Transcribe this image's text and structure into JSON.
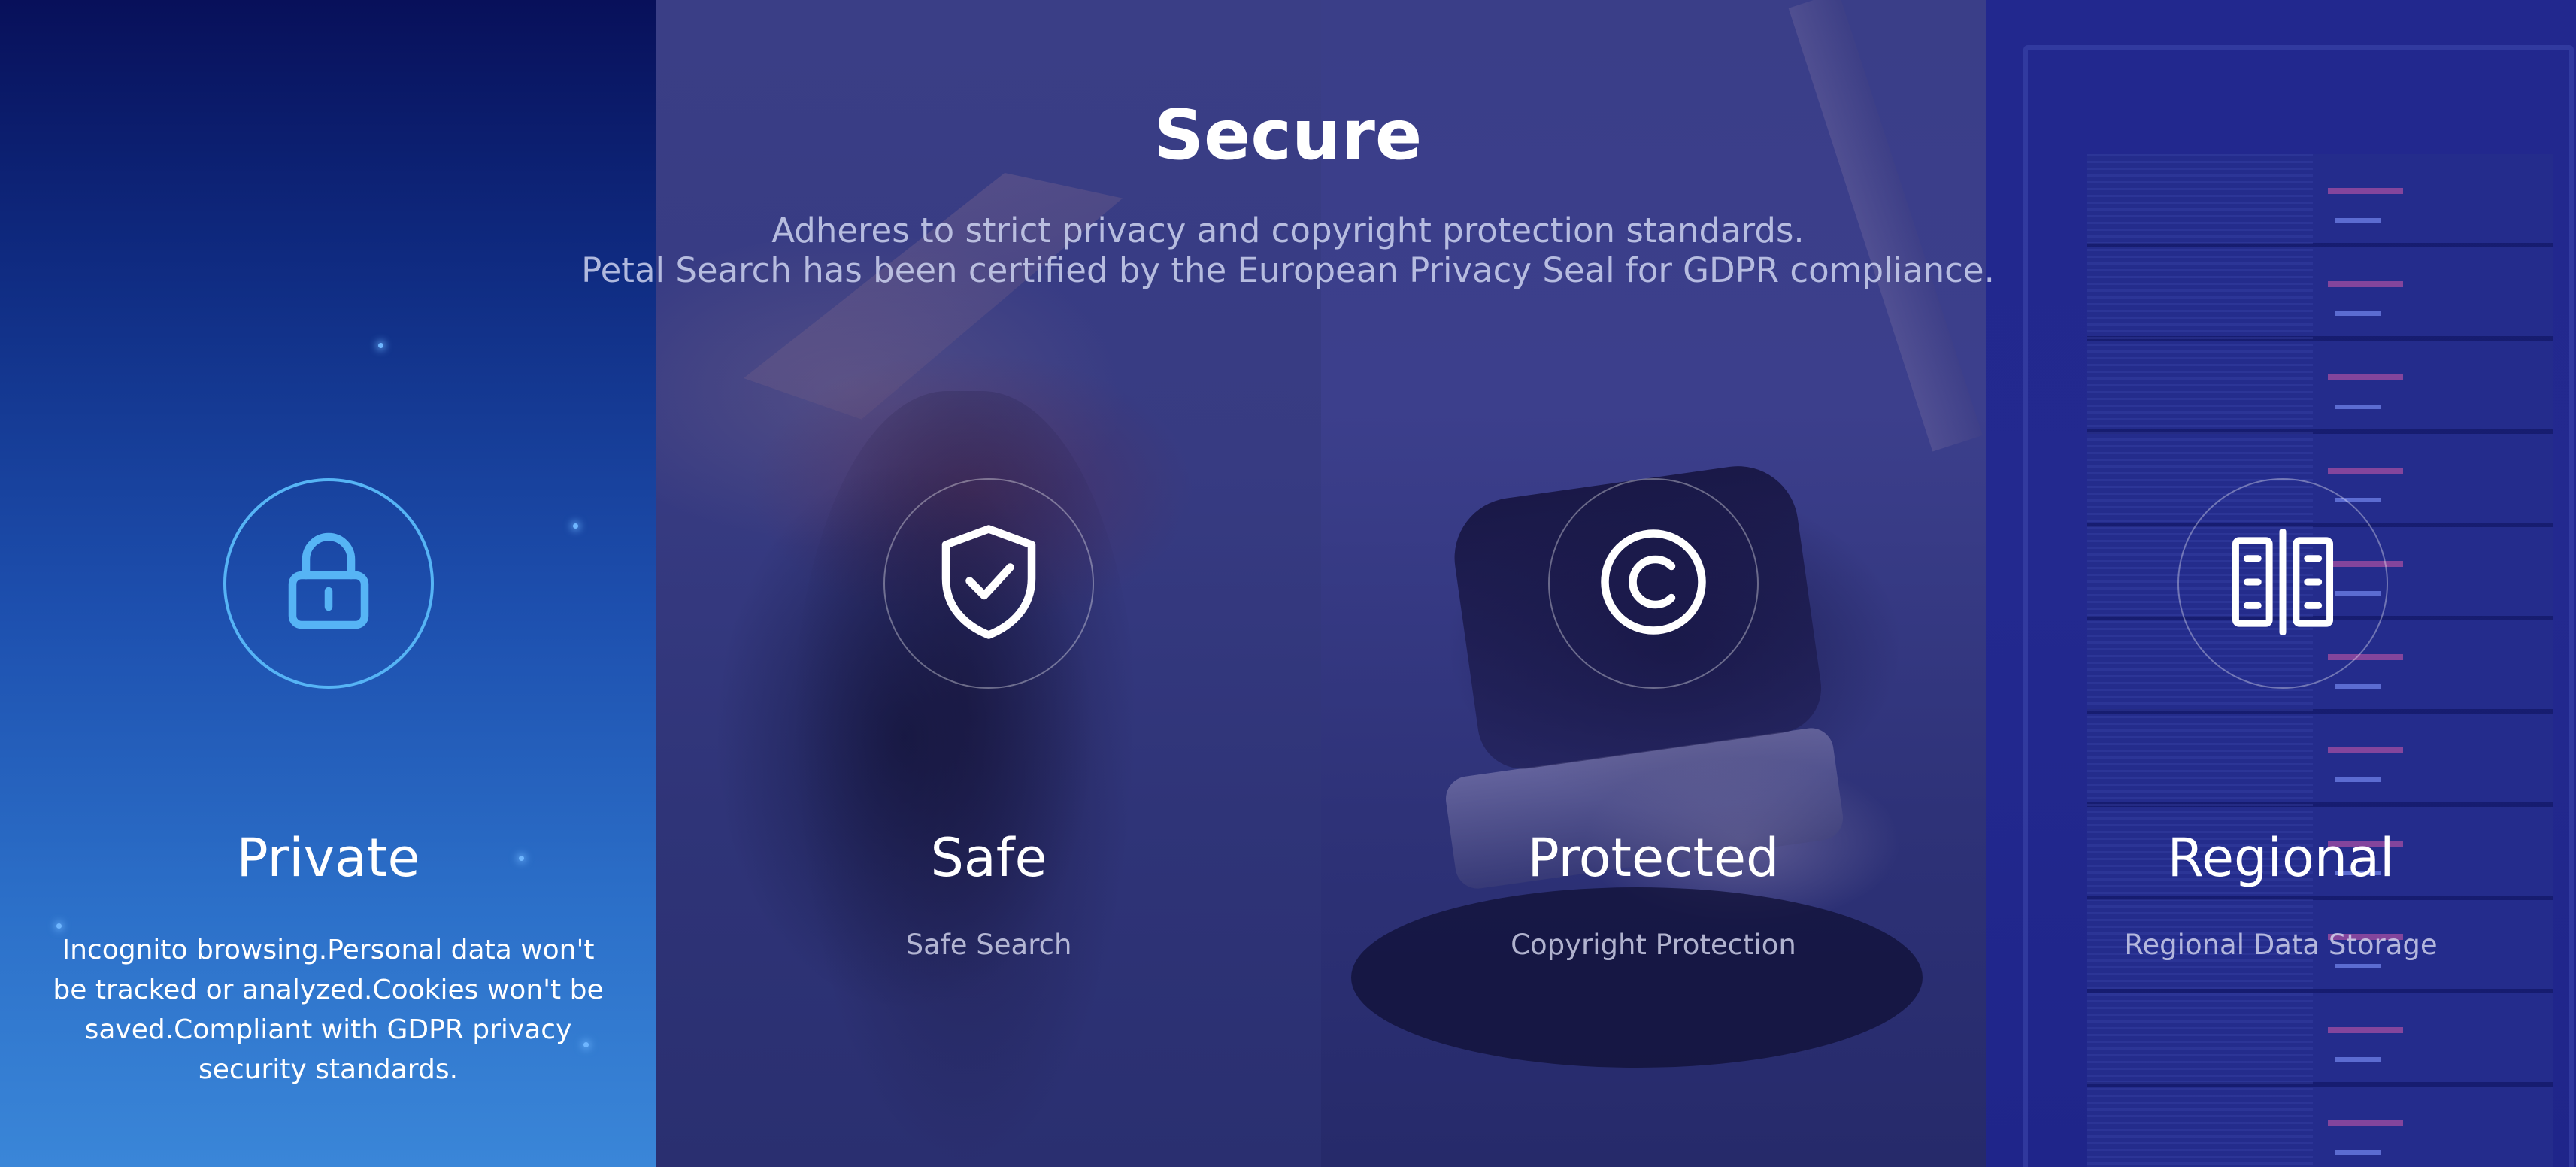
{
  "header": {
    "title": "Secure",
    "subtitle_line1": "Adheres to strict privacy and copyright protection standards.",
    "subtitle_line2": "Petal Search has been certified by the European Privacy Seal for GDPR compliance."
  },
  "features": [
    {
      "icon": "lock-icon",
      "title": "Private",
      "description": "Incognito browsing.Personal data won't be tracked or analyzed.Cookies won't be saved.Compliant with GDPR privacy security standards.",
      "active": true
    },
    {
      "icon": "shield-check-icon",
      "title": "Safe",
      "subtitle": "Safe Search"
    },
    {
      "icon": "copyright-icon",
      "title": "Protected",
      "subtitle": "Copyright Protection"
    },
    {
      "icon": "server-icon",
      "title": "Regional",
      "subtitle": "Regional Data Storage"
    }
  ],
  "colors": {
    "active_icon": "#56b4f5",
    "active_gradient_top": "#08105a",
    "active_gradient_bottom": "#3a86d8",
    "overlay": "#373b82"
  }
}
